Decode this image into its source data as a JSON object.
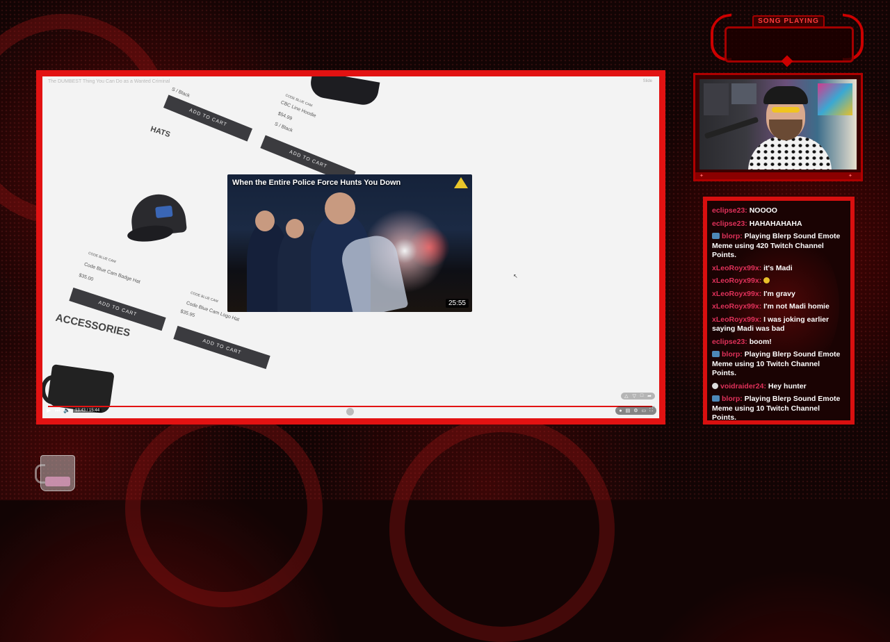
{
  "video": {
    "title": "The DUMBEST Thing You Can Do as a Wanted Criminal",
    "corner_label": "Slide",
    "shop": {
      "items": [
        {
          "label": "CODE BLUE CAM",
          "name": "CBC Line Hoodie",
          "price": "$54.99",
          "variant": "S / Black",
          "button": "ADD TO CART"
        },
        {
          "label": "CODE BLUE CAM",
          "name": "Code Blue Cam Badge Hat",
          "price": "$35.00",
          "button": "ADD TO CART"
        },
        {
          "label": "CODE BLUE CAM",
          "name": "Code Blue Cam Logo Hat",
          "price": "$35.95",
          "button": "ADD TO CART"
        }
      ],
      "top_button": "ADD TO CART",
      "heading_hats": "HATS",
      "heading_accessories": "ACCESSORIES",
      "top_variant": "S / Black"
    },
    "thumbnail": {
      "title": "When the Entire Police Force Hunts You Down",
      "duration": "25:55"
    },
    "player": {
      "time": "13:43 / 15:44",
      "progress": 0.995,
      "play_icon": "play-icon",
      "volume_icon": "volume-icon"
    }
  },
  "overlay": {
    "song_label": "SONG PLAYING"
  },
  "chat": {
    "messages": [
      {
        "user": "eclipse23:",
        "text": "NOOOO",
        "badge": null
      },
      {
        "user": "eclipse23:",
        "text": "HAHAHAHAHA",
        "badge": null
      },
      {
        "user": "blorp:",
        "text": "Playing Blerp Sound Emote Meme using 420 Twitch Channel Points.",
        "badge": "blerp"
      },
      {
        "user": "xLeoRoyx99x:",
        "text": "it's Madi",
        "badge": null
      },
      {
        "user": "xLeoRoyx99x:",
        "text": "",
        "badge": null,
        "emote": true
      },
      {
        "user": "xLeoRoyx99x:",
        "text": "I'm gravy",
        "badge": null
      },
      {
        "user": "xLeoRoyx99x:",
        "text": "I'm not Madi homie",
        "badge": null
      },
      {
        "user": "xLeoRoyx99x:",
        "text": "I was joking earlier saying Madi was bad",
        "badge": null
      },
      {
        "user": "eclipse23:",
        "text": "boom!",
        "badge": null
      },
      {
        "user": "blorp:",
        "text": "Playing Blerp Sound Emote Meme using 10 Twitch Channel Points.",
        "badge": "blerp"
      },
      {
        "user": "voidraider24:",
        "text": "Hey hunter",
        "badge": "skull"
      },
      {
        "user": "blorp:",
        "text": "Playing Blerp Sound Emote Meme using 10 Twitch Channel Points.",
        "badge": "blerp"
      }
    ]
  },
  "colors": {
    "frame_red": "#e21212",
    "chat_user": "#e0315a",
    "background": "#120404"
  }
}
